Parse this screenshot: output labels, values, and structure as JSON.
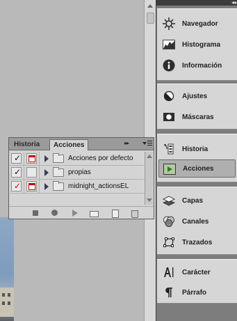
{
  "dock": {
    "collapse_glyph": "◂◂",
    "groups": [
      {
        "items": [
          {
            "label": "Navegador",
            "icon": "navigator-icon"
          },
          {
            "label": "Histograma",
            "icon": "histogram-icon"
          },
          {
            "label": "Información",
            "icon": "info-icon"
          }
        ]
      },
      {
        "items": [
          {
            "label": "Ajustes",
            "icon": "adjustments-icon"
          },
          {
            "label": "Máscaras",
            "icon": "masks-icon"
          }
        ]
      },
      {
        "items": [
          {
            "label": "Historia",
            "icon": "history-icon"
          },
          {
            "label": "Acciones",
            "icon": "actions-icon",
            "active": true
          }
        ]
      },
      {
        "items": [
          {
            "label": "Capas",
            "icon": "layers-icon"
          },
          {
            "label": "Canales",
            "icon": "channels-icon"
          },
          {
            "label": "Trazados",
            "icon": "paths-icon"
          }
        ]
      },
      {
        "items": [
          {
            "label": "Carácter",
            "icon": "character-icon"
          },
          {
            "label": "Párrafo",
            "icon": "paragraph-icon"
          }
        ]
      }
    ]
  },
  "panel": {
    "tabs": [
      {
        "label": "Historia",
        "active": false
      },
      {
        "label": "Acciones",
        "active": true
      }
    ],
    "forward_glyph": "▸▸",
    "rows": [
      {
        "name": "Acciones por defecto",
        "checked": true,
        "check_color": "#111111",
        "dialog_on": true
      },
      {
        "name": "propias",
        "checked": true,
        "check_color": "#111111",
        "dialog_on": false
      },
      {
        "name": "midnight_actionsEL",
        "checked": true,
        "check_color": "#cc0000",
        "dialog_on": true
      }
    ],
    "footer_icons": [
      "stop-icon",
      "record-icon",
      "play-icon",
      "new-set-icon",
      "new-action-icon",
      "delete-icon"
    ]
  },
  "colors": {
    "canvas_bg": "#b9b9b9",
    "dock_bg": "#7d7d7d",
    "dock_group_bg": "#d6d6d6",
    "panel_bg": "#d4d4d4",
    "active_item_bg": "#afafaf",
    "red_accent": "#cc0000"
  }
}
